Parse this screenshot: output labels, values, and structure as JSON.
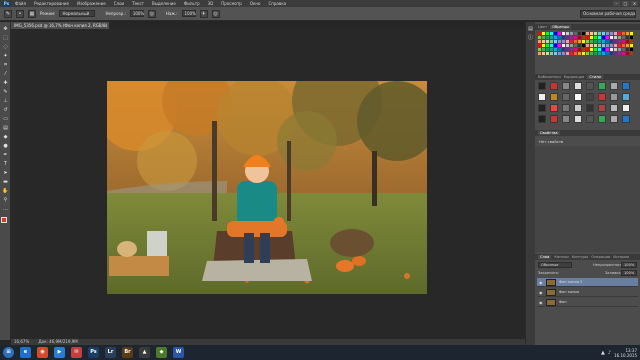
{
  "menubar": {
    "logo": "Ps",
    "items": [
      "Файл",
      "Редактирование",
      "Изображение",
      "Слои",
      "Текст",
      "Выделение",
      "Фильтр",
      "3D",
      "Просмотр",
      "Окно",
      "Справка"
    ],
    "window_controls": [
      "–",
      "□",
      "✕"
    ]
  },
  "options": {
    "mode_label": "Режим:",
    "mode_value": "Нормальный",
    "opacity_label": "Непрозр.:",
    "opacity_value": "100%",
    "flow_label": "Наж.:",
    "flow_value": "100%",
    "workspace": "Основная рабочая среда"
  },
  "document": {
    "tab_title": "IMG_5356.psd @ 16,7% (Фон копия 2, RGB/8)",
    "close": "×"
  },
  "status": {
    "zoom": "16,67%",
    "doc_info": "Док: 46,9M/219,9M"
  },
  "panels": {
    "top_tabs": [
      "Цвет",
      "Образцы"
    ],
    "adjust_tabs": [
      "Библиотеки",
      "Коррекция",
      "Стили"
    ],
    "properties_tabs": [
      "Свойства"
    ],
    "properties_text": "Нет свойств",
    "layers_tabs": [
      "Слои",
      "Каналы",
      "Контуры",
      "Операции",
      "История"
    ],
    "blend_mode": "Обычные",
    "opacity_label": "Непрозрачность:",
    "opacity_value": "100%",
    "lock_label": "Закрепить:",
    "fill_label": "Заливка:",
    "fill_value": "100%",
    "layers": [
      {
        "name": "Фон копия 2",
        "selected": true
      },
      {
        "name": "Фон копия",
        "selected": false
      },
      {
        "name": "Фон",
        "selected": false
      }
    ]
  },
  "taskbar": {
    "apps": [
      {
        "label": "e",
        "color": "#1f6fcf"
      },
      {
        "label": "◉",
        "color": "#d64a2a"
      },
      {
        "label": "▶",
        "color": "#2a7bd6"
      },
      {
        "label": "✉",
        "color": "#c04040"
      },
      {
        "label": "Ps",
        "color": "#1a3d66"
      },
      {
        "label": "Lr",
        "color": "#2b3f5c"
      },
      {
        "label": "Br",
        "color": "#5c3a14"
      },
      {
        "label": "▲",
        "color": "#3a3a3a"
      },
      {
        "label": "◆",
        "color": "#4c7a2a"
      },
      {
        "label": "W",
        "color": "#2a56a8"
      }
    ],
    "time": "13:37",
    "date": "16.10.2015"
  },
  "colors": {
    "foreground": "#d63a2a",
    "background": "#ffffff"
  }
}
